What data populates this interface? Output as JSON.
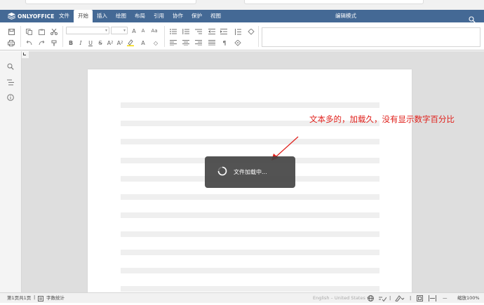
{
  "titlebar": {
    "brand": "ONLYOFFICE",
    "mode": "编辑模式",
    "menu": [
      "文件",
      "开始",
      "插入",
      "绘图",
      "布局",
      "引用",
      "协作",
      "保护",
      "视图"
    ],
    "active_menu_index": 1
  },
  "toolbar": {
    "font_inc": "A",
    "font_dec": "A",
    "change_case": "Aa",
    "bold": "B",
    "italic": "I",
    "underline": "U",
    "strike": "S",
    "superscript": "A",
    "subscript": "A",
    "highlight_color": "#f5d800",
    "font_color": "A",
    "clear_style": "◇"
  },
  "document": {
    "annotation": "文本多的，加载久，没有显示数字百分比",
    "loading_text": "文件加载中..."
  },
  "statusbar": {
    "page_info": "第1页共1页",
    "word_count": "字数统计",
    "language": "English – United States",
    "zoom": "缩放100%"
  },
  "colors": {
    "titlebar": "#446995",
    "annotation": "#e0201b",
    "loader_bg": "#444444"
  }
}
